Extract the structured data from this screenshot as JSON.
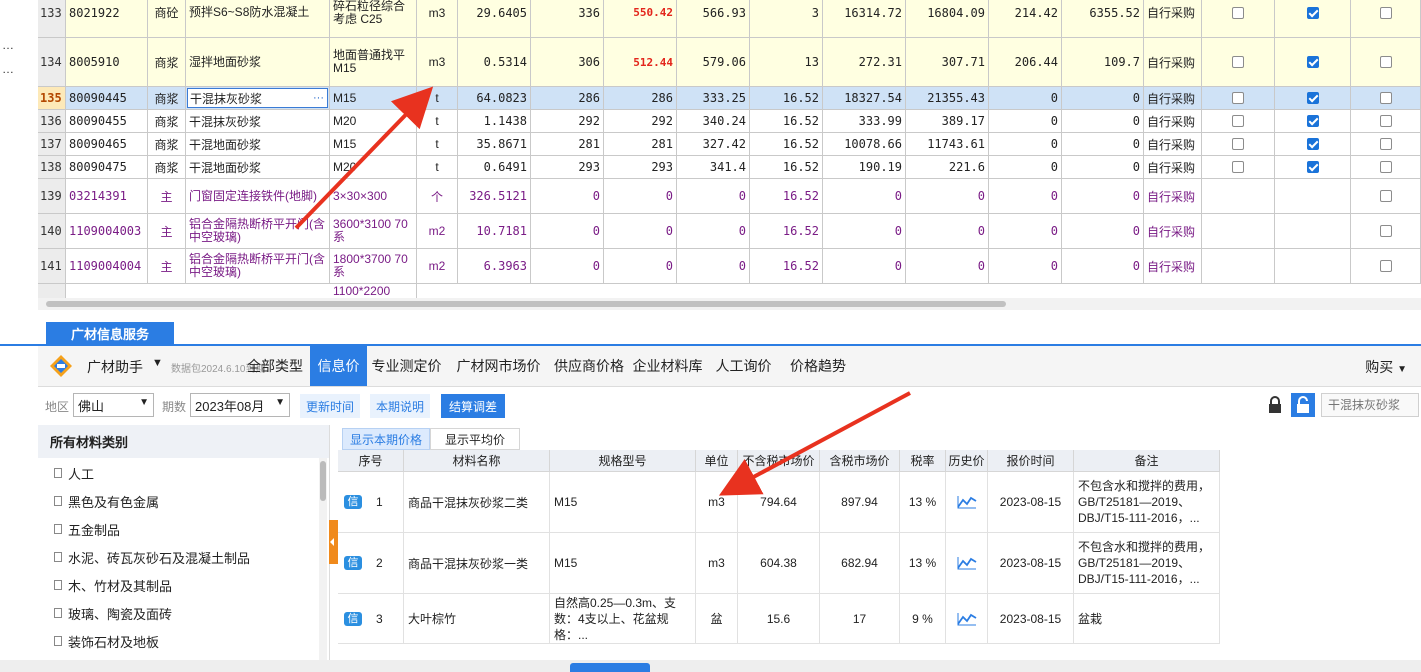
{
  "grid": {
    "rows": [
      {
        "n": "133",
        "code": "8021922",
        "type": "商砼",
        "name": "预拌S6~S8防水混凝土",
        "spec": "碎石粒径综合考虑 C25",
        "unit": "m3",
        "qty": "29.6405",
        "p1": "336",
        "p2": "550.42",
        "p3": "566.93",
        "rate": "3",
        "t1": "16314.72",
        "t2": "16804.09",
        "d1": "214.42",
        "d2": "6355.52",
        "src": "自行采购",
        "cb1": false,
        "cb2": true,
        "cb3": false
      },
      {
        "n": "134",
        "code": "8005910",
        "type": "商浆",
        "name": "湿拌地面砂浆",
        "spec": "地面普通找平 M15",
        "unit": "m3",
        "qty": "0.5314",
        "p1": "306",
        "p2": "512.44",
        "p3": "579.06",
        "rate": "13",
        "t1": "272.31",
        "t2": "307.71",
        "d1": "206.44",
        "d2": "109.7",
        "src": "自行采购",
        "cb1": false,
        "cb2": true,
        "cb3": false
      },
      {
        "n": "135",
        "code": "80090445",
        "type": "商浆",
        "name": "干混抹灰砂浆",
        "spec": "M15",
        "unit": "t",
        "qty": "64.0823",
        "p1": "286",
        "p2": "286",
        "p3": "333.25",
        "rate": "16.52",
        "t1": "18327.54",
        "t2": "21355.43",
        "d1": "0",
        "d2": "0",
        "src": "自行采购",
        "cb1": false,
        "cb2": true,
        "cb3": false
      },
      {
        "n": "136",
        "code": "80090455",
        "type": "商浆",
        "name": "干混抹灰砂浆",
        "spec": "M20",
        "unit": "t",
        "qty": "1.1438",
        "p1": "292",
        "p2": "292",
        "p3": "340.24",
        "rate": "16.52",
        "t1": "333.99",
        "t2": "389.17",
        "d1": "0",
        "d2": "0",
        "src": "自行采购",
        "cb1": false,
        "cb2": true,
        "cb3": false
      },
      {
        "n": "137",
        "code": "80090465",
        "type": "商浆",
        "name": "干混地面砂浆",
        "spec": "M15",
        "unit": "t",
        "qty": "35.8671",
        "p1": "281",
        "p2": "281",
        "p3": "327.42",
        "rate": "16.52",
        "t1": "10078.66",
        "t2": "11743.61",
        "d1": "0",
        "d2": "0",
        "src": "自行采购",
        "cb1": false,
        "cb2": true,
        "cb3": false
      },
      {
        "n": "138",
        "code": "80090475",
        "type": "商浆",
        "name": "干混地面砂浆",
        "spec": "M20",
        "unit": "t",
        "qty": "0.6491",
        "p1": "293",
        "p2": "293",
        "p3": "341.4",
        "rate": "16.52",
        "t1": "190.19",
        "t2": "221.6",
        "d1": "0",
        "d2": "0",
        "src": "自行采购",
        "cb1": false,
        "cb2": true,
        "cb3": false
      },
      {
        "n": "139",
        "code": "03214391",
        "type": "主",
        "name": "门窗固定连接铁件(地脚)",
        "spec": "3×30×300",
        "unit": "个",
        "qty": "326.5121",
        "p1": "0",
        "p2": "0",
        "p3": "0",
        "rate": "16.52",
        "t1": "0",
        "t2": "0",
        "d1": "0",
        "d2": "0",
        "src": "自行采购",
        "cb3": false
      },
      {
        "n": "140",
        "code": "1109004003",
        "type": "主",
        "name": "铝合金隔热断桥平开门(含中空玻璃)",
        "spec": "3600*3100 70系",
        "unit": "m2",
        "qty": "10.7181",
        "p1": "0",
        "p2": "0",
        "p3": "0",
        "rate": "16.52",
        "t1": "0",
        "t2": "0",
        "d1": "0",
        "d2": "0",
        "src": "自行采购",
        "cb3": false
      },
      {
        "n": "141",
        "code": "1109004004",
        "type": "主",
        "name": "铝合金隔热断桥平开门(含中空玻璃)",
        "spec": "1800*3700 70系",
        "unit": "m2",
        "qty": "6.3963",
        "p1": "0",
        "p2": "0",
        "p3": "0",
        "rate": "16.52",
        "t1": "0",
        "t2": "0",
        "d1": "0",
        "d2": "0",
        "src": "自行采购",
        "cb3": false
      }
    ],
    "partial_row_spec": "1100*2200"
  },
  "panel": {
    "service_tab": "广材信息服务",
    "brand": "广材助手",
    "package_note": "数据包2024.6.10到期",
    "nav_tabs": [
      "全部类型",
      "信息价",
      "专业测定价",
      "广材网市场价",
      "供应商价格",
      "企业材料库",
      "人工询价",
      "价格趋势"
    ],
    "active_nav": "信息价",
    "buy_label": "购买",
    "filters": {
      "region_label": "地区",
      "region_value": "佛山",
      "period_label": "期数",
      "period_value": "2023年08月",
      "btn_update_time": "更新时间",
      "btn_period_desc": "本期说明",
      "btn_settle_adjust": "结算调差",
      "search_placeholder": "干混抹灰砂浆"
    },
    "sidebar": {
      "title": "所有材料类别",
      "items": [
        "人工",
        "黑色及有色金属",
        "五金制品",
        "水泥、砖瓦灰砂石及混凝土制品",
        "木、竹材及其制品",
        "玻璃、陶瓷及面砖",
        "装饰石材及地板"
      ]
    },
    "price_tabs": [
      "显示本期价格",
      "显示平均价"
    ],
    "table": {
      "headers": [
        "序号",
        "材料名称",
        "规格型号",
        "单位",
        "不含税市场价",
        "含税市场价",
        "税率",
        "历史价",
        "报价时间",
        "备注"
      ],
      "badge": "信",
      "rows": [
        {
          "no": "1",
          "name": "商品干混抹灰砂浆二类",
          "spec": "M15",
          "unit": "m3",
          "price_ex": "794.64",
          "price_in": "897.94",
          "tax": "13 %",
          "date": "2023-08-15",
          "note": "不包含水和搅拌的费用，GB/T25181—2019、DBJ/T15-111-2016，..."
        },
        {
          "no": "2",
          "name": "商品干混抹灰砂浆一类",
          "spec": "M15",
          "unit": "m3",
          "price_ex": "604.38",
          "price_in": "682.94",
          "tax": "13 %",
          "date": "2023-08-15",
          "note": "不包含水和搅拌的费用，GB/T25181—2019、DBJ/T15-111-2016，..."
        },
        {
          "no": "3",
          "name": "大叶棕竹",
          "spec": "自然高0.25—0.3m、支数：4支以上、花盆规格：...",
          "unit": "盆",
          "price_ex": "15.6",
          "price_in": "17",
          "tax": "9 %",
          "date": "2023-08-15",
          "note": "盆栽"
        }
      ]
    }
  },
  "colors": {
    "accent": "#2b7de3",
    "selected_row": "#cfe2f6",
    "yellow_row": "#ffffe1",
    "purple_text": "#7a1c86",
    "red_price": "#e3261c",
    "annotation_arrow": "#e8321f"
  }
}
